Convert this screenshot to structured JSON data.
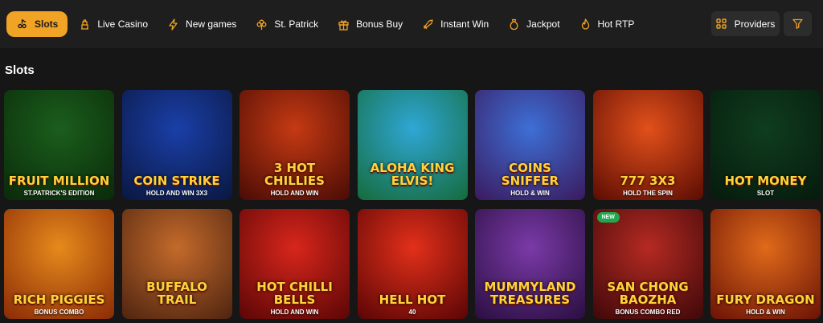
{
  "categories": [
    {
      "label": "Slots",
      "icon": "slots-icon",
      "active": true
    },
    {
      "label": "Live Casino",
      "icon": "live-casino-icon",
      "active": false
    },
    {
      "label": "New games",
      "icon": "bolt-icon",
      "active": false
    },
    {
      "label": "St. Patrick",
      "icon": "clover-icon",
      "active": false
    },
    {
      "label": "Bonus Buy",
      "icon": "gift-icon",
      "active": false
    },
    {
      "label": "Instant Win",
      "icon": "rocket-icon",
      "active": false
    },
    {
      "label": "Jackpot",
      "icon": "money-bag-icon",
      "active": false
    },
    {
      "label": "Hot RTP",
      "icon": "flame-icon",
      "active": false
    }
  ],
  "providers_label": "Providers",
  "section_title": "Slots",
  "colors": {
    "accent": "#f0a324",
    "bg": "#161616",
    "topbar": "#1e1e1e",
    "button": "#2c2c2c"
  },
  "games": [
    {
      "title": "Fruit Million",
      "subtitle": "St.Patrick's Edition",
      "bg": [
        "#1b5e1c",
        "#0a2a0a"
      ],
      "badge": ""
    },
    {
      "title": "Coin Strike",
      "subtitle": "Hold and Win 3x3",
      "bg": [
        "#1a3fa8",
        "#0a1740"
      ],
      "badge": ""
    },
    {
      "title": "3 Hot Chillies",
      "subtitle": "Hold and Win",
      "bg": [
        "#c53a13",
        "#4a0b05"
      ],
      "badge": ""
    },
    {
      "title": "Aloha King Elvis!",
      "subtitle": "",
      "bg": [
        "#2fa7d6",
        "#156b3b"
      ],
      "badge": ""
    },
    {
      "title": "Coins Sniffer",
      "subtitle": "Hold & Win",
      "bg": [
        "#3d6fd6",
        "#3a1a5e"
      ],
      "badge": ""
    },
    {
      "title": "777 3x3",
      "subtitle": "Hold the Spin",
      "bg": [
        "#e2501b",
        "#5b0c03"
      ],
      "badge": ""
    },
    {
      "title": "Hot Money",
      "subtitle": "Slot",
      "bg": [
        "#0f3d1e",
        "#061a0d"
      ],
      "badge": ""
    },
    {
      "title": "Rich Piggies",
      "subtitle": "Bonus Combo",
      "bg": [
        "#e68a1c",
        "#8a2a06"
      ],
      "badge": ""
    },
    {
      "title": "Buffalo Trail",
      "subtitle": "",
      "bg": [
        "#c46a2b",
        "#4e2410"
      ],
      "badge": ""
    },
    {
      "title": "Hot Chilli Bells",
      "subtitle": "Hold and Win",
      "bg": [
        "#d8261b",
        "#5a0606"
      ],
      "badge": ""
    },
    {
      "title": "Hell Hot",
      "subtitle": "40",
      "bg": [
        "#e2301a",
        "#5a0505"
      ],
      "badge": ""
    },
    {
      "title": "Mummyland Treasures",
      "subtitle": "",
      "bg": [
        "#7a3aa8",
        "#2a0e40"
      ],
      "badge": ""
    },
    {
      "title": "San Chong Baozha",
      "subtitle": "Bonus Combo Red",
      "bg": [
        "#b52a22",
        "#3e0809"
      ],
      "badge": "NEW"
    },
    {
      "title": "Fury Dragon",
      "subtitle": "Hold & Win",
      "bg": [
        "#e06a1a",
        "#6a1206"
      ],
      "badge": ""
    }
  ]
}
